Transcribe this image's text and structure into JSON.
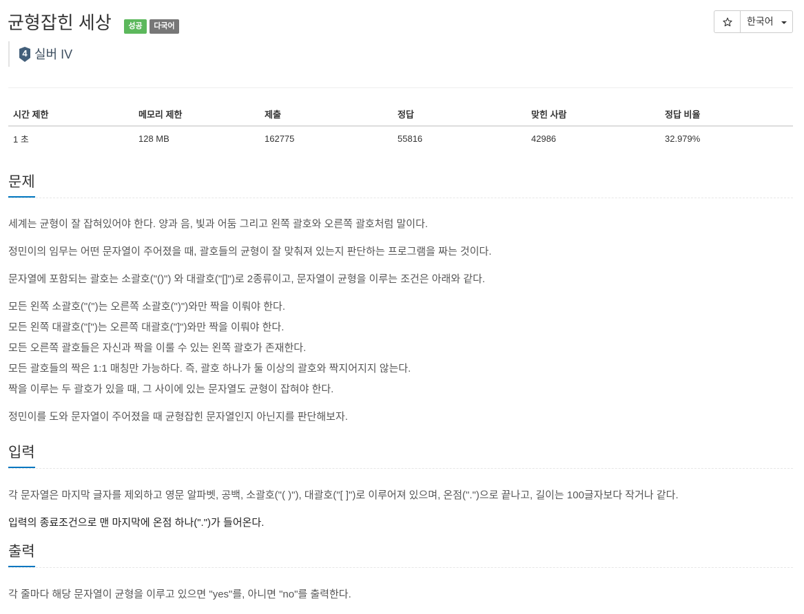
{
  "problem": {
    "title": "균형잡힌 세상",
    "badges": {
      "success": "성공",
      "multilingual": "다국어"
    },
    "tier": {
      "number": "4",
      "label": "실버 IV",
      "icon": "silver-tier-icon"
    }
  },
  "toolbar": {
    "favorite_icon": "star-icon",
    "language": "한국어",
    "language_caret_icon": "caret-down-icon"
  },
  "stats": {
    "headers": [
      "시간 제한",
      "메모리 제한",
      "제출",
      "정답",
      "맞힌 사람",
      "정답 비율"
    ],
    "values": [
      "1 초",
      "128 MB",
      "162775",
      "55816",
      "42986",
      "32.979%"
    ]
  },
  "sections": {
    "description": {
      "heading": "문제",
      "paragraphs": [
        "세계는 균형이 잘 잡혀있어야 한다. 양과 음, 빛과 어둠 그리고 왼쪽 괄호와 오른쪽 괄호처럼 말이다.",
        "정민이의 임무는 어떤 문자열이 주어졌을 때, 괄호들의 균형이 잘 맞춰져 있는지 판단하는 프로그램을 짜는 것이다.",
        "문자열에 포함되는 괄호는 소괄호(\"()\") 와 대괄호(\"[]\")로 2종류이고, 문자열이 균형을 이루는 조건은 아래와 같다."
      ],
      "conditions": [
        "모든 왼쪽 소괄호(\"(\")는 오른쪽 소괄호(\")\")와만 짝을 이뤄야 한다.",
        "모든 왼쪽 대괄호(\"[\")는 오른쪽 대괄호(\"]\")와만 짝을 이뤄야 한다.",
        "모든 오른쪽 괄호들은 자신과 짝을 이룰 수 있는 왼쪽 괄호가 존재한다.",
        "모든 괄호들의 짝은 1:1 매칭만 가능하다. 즉, 괄호 하나가 둘 이상의 괄호와 짝지어지지 않는다.",
        "짝을 이루는 두 괄호가 있을 때, 그 사이에 있는 문자열도 균형이 잡혀야 한다."
      ],
      "closing": "정민이를 도와 문자열이 주어졌을 때 균형잡힌 문자열인지 아닌지를 판단해보자."
    },
    "input": {
      "heading": "입력",
      "paragraphs": [
        "각 문자열은 마지막 글자를 제외하고 영문 알파벳, 공백, 소괄호(\"( )\"), 대괄호(\"[ ]\")로 이루어져 있으며, 온점(\".\")으로 끝나고, 길이는 100글자보다 작거나 같다.",
        "입력의 종료조건으로 맨 마지막에 온점 하나(\".\")가 들어온다."
      ]
    },
    "output": {
      "heading": "출력",
      "paragraphs": [
        "각 줄마다 해당 문자열이 균형을 이루고 있으면 \"yes\"를, 아니면 \"no\"를 출력한다."
      ]
    }
  },
  "colors": {
    "accent": "#0076c0",
    "badge-success": "#5cb85c",
    "badge-default": "#777777",
    "tier-silver": "#435f7a"
  }
}
